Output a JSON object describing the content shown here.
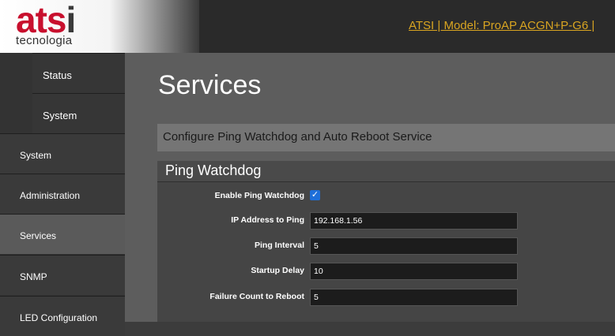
{
  "logo": {
    "brand_red": "ats",
    "brand_dark": "i",
    "sub": "tecnologia"
  },
  "header": {
    "links": "ATSI   |   Model: ProAP ACGN+P-G6   |"
  },
  "sidebar": {
    "items": [
      {
        "label": "Status",
        "kind": "section"
      },
      {
        "label": "System",
        "kind": "section"
      },
      {
        "label": "System",
        "kind": "item"
      },
      {
        "label": "Administration",
        "kind": "item"
      },
      {
        "label": "Services",
        "kind": "item",
        "active": true
      },
      {
        "label": "SNMP",
        "kind": "item"
      },
      {
        "label": "LED Configuration",
        "kind": "item"
      }
    ]
  },
  "main": {
    "title": "Services",
    "description": "Configure Ping Watchdog and Auto Reboot Service",
    "section_title": "Ping Watchdog",
    "fields": {
      "enable_label": "Enable Ping Watchdog",
      "enable_checked": true,
      "ip_label": "IP Address to Ping",
      "ip_value": "192.168.1.56",
      "interval_label": "Ping Interval",
      "interval_value": "5",
      "startup_label": "Startup Delay",
      "startup_value": "10",
      "failure_label": "Failure Count to Reboot",
      "failure_value": "5"
    }
  },
  "colors": {
    "brand_red": "#c8102e",
    "link_gold": "#d9a521",
    "checkbox_blue": "#1e6fd9"
  }
}
